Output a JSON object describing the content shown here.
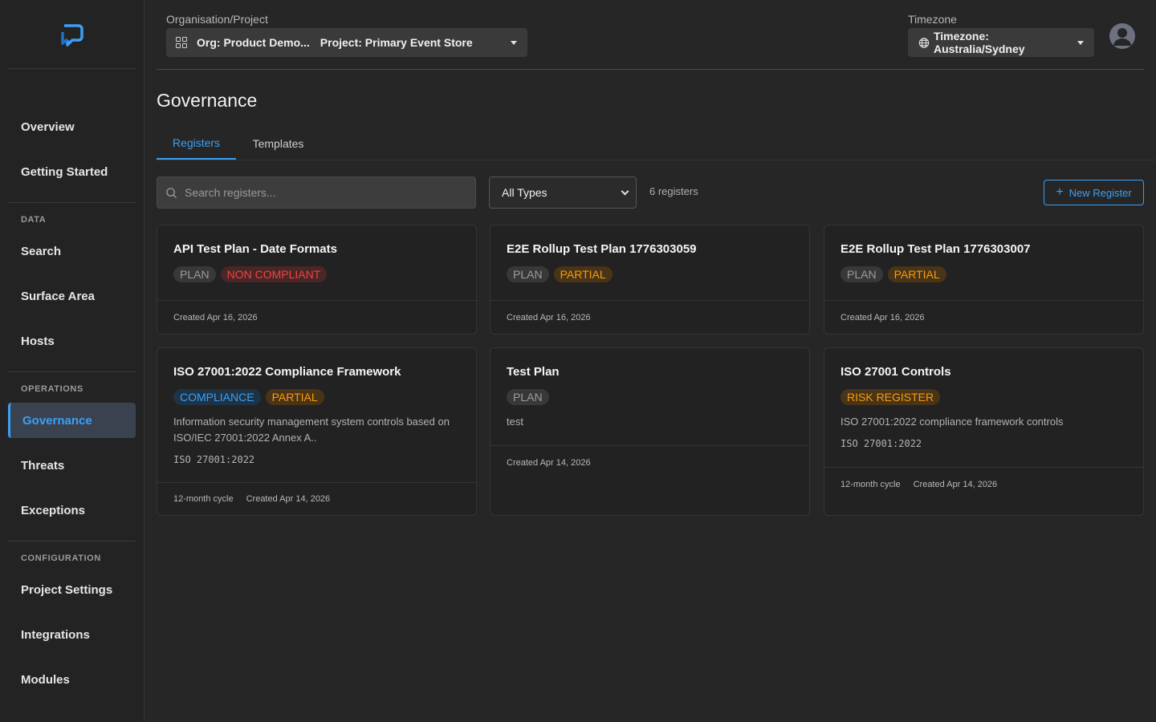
{
  "sidebar": {
    "items": {
      "overview": "Overview",
      "getting_started": "Getting Started",
      "search": "Search",
      "surface_area": "Surface Area",
      "hosts": "Hosts",
      "governance": "Governance",
      "threats": "Threats",
      "exceptions": "Exceptions",
      "project_settings": "Project Settings",
      "integrations": "Integrations",
      "modules": "Modules"
    },
    "sections": {
      "data": "DATA",
      "operations": "OPERATIONS",
      "configuration": "CONFIGURATION"
    },
    "active": "Governance"
  },
  "header": {
    "org_project_label": "Organisation/Project",
    "org": "Org: Product Demo...",
    "project": "Project: Primary Event Store",
    "timezone_label": "Timezone",
    "timezone": "Timezone: Australia/Sydney"
  },
  "page": {
    "title": "Governance",
    "tabs": [
      "Registers",
      "Templates"
    ],
    "active_tab": "Registers"
  },
  "toolbar": {
    "search_placeholder": "Search registers...",
    "type_filter": "All Types",
    "count": "6 registers",
    "new_button": "New Register"
  },
  "cards": [
    {
      "title": "API Test Plan - Date Formats",
      "badges": [
        {
          "text": "PLAN",
          "kind": "plan"
        },
        {
          "text": "NON COMPLIANT",
          "kind": "noncomp"
        }
      ],
      "description": "",
      "standard": "",
      "cycle": "",
      "created": "Created Apr 16, 2026"
    },
    {
      "title": "E2E Rollup Test Plan 1776303059",
      "badges": [
        {
          "text": "PLAN",
          "kind": "plan"
        },
        {
          "text": "PARTIAL",
          "kind": "partial"
        }
      ],
      "description": "",
      "standard": "",
      "cycle": "",
      "created": "Created Apr 16, 2026"
    },
    {
      "title": "E2E Rollup Test Plan 1776303007",
      "badges": [
        {
          "text": "PLAN",
          "kind": "plan"
        },
        {
          "text": "PARTIAL",
          "kind": "partial"
        }
      ],
      "description": "",
      "standard": "",
      "cycle": "",
      "created": "Created Apr 16, 2026"
    },
    {
      "title": "ISO 27001:2022 Compliance Framework",
      "badges": [
        {
          "text": "COMPLIANCE",
          "kind": "compliance"
        },
        {
          "text": "PARTIAL",
          "kind": "partial"
        }
      ],
      "description": "Information security management system controls based on ISO/IEC 27001:2022 Annex A..",
      "standard": "ISO 27001:2022",
      "cycle": "12-month cycle",
      "created": "Created Apr 14, 2026"
    },
    {
      "title": "Test Plan",
      "badges": [
        {
          "text": "PLAN",
          "kind": "plan"
        }
      ],
      "description": "test",
      "standard": "",
      "cycle": "",
      "created": "Created Apr 14, 2026"
    },
    {
      "title": "ISO 27001 Controls",
      "badges": [
        {
          "text": "RISK REGISTER",
          "kind": "risk"
        }
      ],
      "description": "ISO 27001:2022 compliance framework controls",
      "standard": "ISO 27001:2022",
      "cycle": "12-month cycle",
      "created": "Created Apr 14, 2026"
    }
  ],
  "colors": {
    "accent": "#3aa0f5",
    "background": "#262626",
    "danger": "#ef4444",
    "warning": "#f59e0b"
  }
}
